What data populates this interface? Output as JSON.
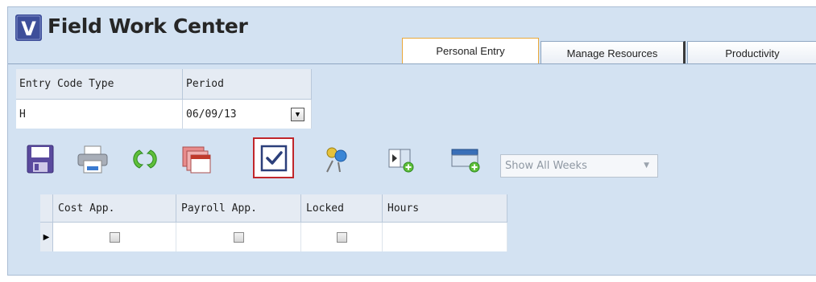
{
  "header": {
    "title": "Field Work Center",
    "logo_letter": "V"
  },
  "tabs": [
    {
      "label": "Personal Entry",
      "active": true
    },
    {
      "label": "Manage Resources",
      "active": false
    },
    {
      "label": "Productivity",
      "active": false
    }
  ],
  "filters": {
    "entry_code_type": {
      "label": "Entry Code Type",
      "value": "H"
    },
    "period": {
      "label": "Period",
      "value": "06/09/13"
    }
  },
  "toolbar": {
    "weeks_select": {
      "value": "Show All Weeks",
      "enabled": false
    },
    "icons": [
      "save-icon",
      "print-icon",
      "refresh-icon",
      "calendar-icon",
      "approve-check-icon",
      "pin-icon",
      "add-column-icon",
      "add-row-icon"
    ],
    "highlight_color": "#c0262b"
  },
  "grid": {
    "columns": [
      "Cost App.",
      "Payroll App.",
      "Locked",
      "Hours"
    ],
    "rows": [
      {
        "cost_app": false,
        "payroll_app": false,
        "locked": false,
        "hours": ""
      }
    ]
  },
  "colors": {
    "panel": "#d3e2f2",
    "active_tab_border": "#e9a83b",
    "logo": "#3e4f9a"
  }
}
